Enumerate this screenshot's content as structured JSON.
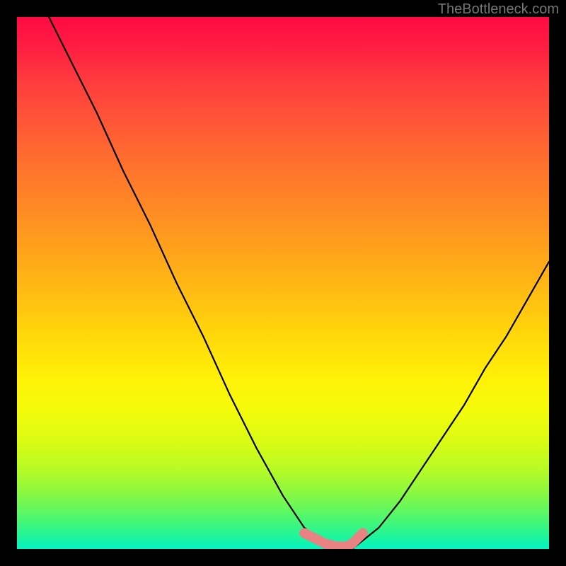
{
  "watermark": "TheBottleneck.com",
  "chart_data": {
    "type": "line",
    "title": "",
    "xlabel": "",
    "ylabel": "",
    "xlim": [
      0,
      100
    ],
    "ylim": [
      0,
      100
    ],
    "series": [
      {
        "name": "black-curve",
        "color": "#000000",
        "x": [
          6,
          10,
          15,
          20,
          25,
          30,
          35,
          40,
          45,
          50,
          54,
          58,
          60,
          63,
          68,
          72,
          76,
          80,
          84,
          88,
          92,
          96,
          100
        ],
        "values": [
          100,
          92,
          82,
          71,
          61,
          50,
          40,
          29,
          19,
          10,
          4,
          1,
          0,
          0,
          4,
          9,
          15,
          21,
          27,
          34,
          40,
          47,
          54
        ]
      },
      {
        "name": "pink-highlight",
        "color": "#e98383",
        "x": [
          54,
          56,
          58,
          60,
          62,
          63,
          65
        ],
        "values": [
          3,
          2,
          1,
          0.5,
          0.5,
          1,
          3
        ]
      }
    ]
  }
}
